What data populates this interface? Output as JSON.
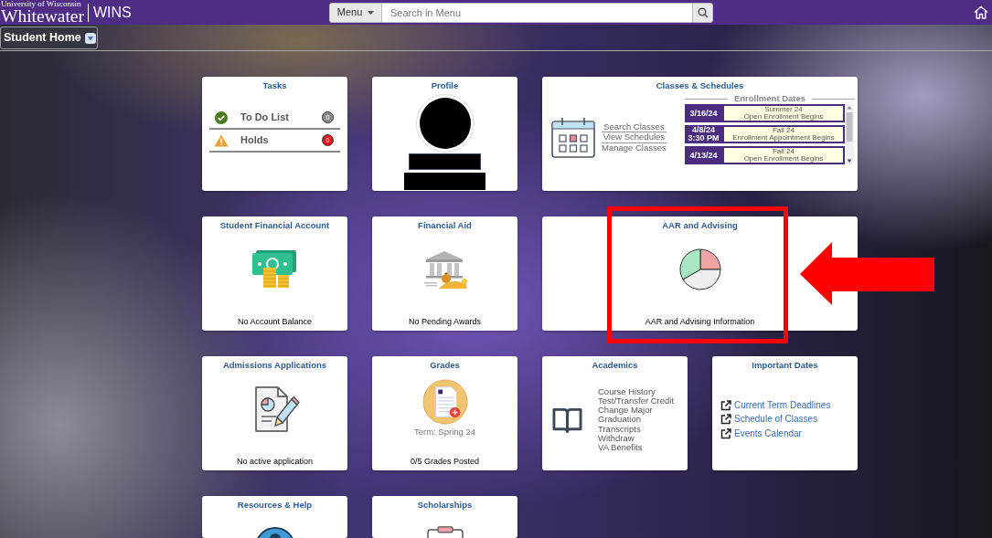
{
  "header": {
    "logo": {
      "line_1": "University of Wisconsin",
      "line_2": "Whitewater",
      "app_name": "WINS"
    },
    "menu_button": "Menu",
    "search": {
      "placeholder": "Search in Menu"
    }
  },
  "page_title": "Student Home",
  "tiles": [
    {
      "kind": "tasks",
      "title": "Tasks",
      "highlighted": false,
      "tasks": [
        {
          "kind": "ok",
          "label": "To Do List",
          "count": "0",
          "color": "#8c8c8c"
        },
        {
          "kind": "alert",
          "label": "Holds",
          "count": "0",
          "color": "#e2141c"
        }
      ]
    },
    {
      "kind": "profile",
      "title": "Profile",
      "highlighted": false
    },
    {
      "kind": "classes",
      "title": "Classes & Schedules",
      "highlighted": false,
      "links": [
        "Search Classes",
        "View Schedules",
        "Manage Classes"
      ],
      "enrollment": {
        "heading": "Enrollment Dates",
        "items": [
          {
            "date": "3/16/24",
            "term": "Summer 24",
            "event": "Open Enrollment Begins"
          },
          {
            "date": "4/8/24",
            "time": "3:30 PM",
            "term": "Fall 24",
            "event": "Enrollment Appointment Begins"
          },
          {
            "date": "4/13/24",
            "term": "Fall 24",
            "event": "Open Enrollment Begins"
          }
        ]
      }
    },
    {
      "kind": "account",
      "title": "Student Financial Account",
      "highlighted": false,
      "footer": "No Account Balance"
    },
    {
      "kind": "aid",
      "title": "Financial Aid",
      "highlighted": false,
      "footer": "No Pending Awards"
    },
    {
      "kind": "advising",
      "title": "AAR and Advising",
      "highlighted": true,
      "footer": "AAR and Advising Information"
    },
    {
      "kind": "admissions",
      "title": "Admissions Applications",
      "highlighted": false,
      "footer": "No active application"
    },
    {
      "kind": "grades",
      "title": "Grades",
      "highlighted": false,
      "term": "Term: Spring 24",
      "footer": "0/5 Grades Posted"
    },
    {
      "kind": "academics",
      "title": "Academics",
      "highlighted": false,
      "links": [
        "Course History",
        "Test/Transfer Credit",
        "Change Major",
        "Graduation",
        "Transcripts",
        "Withdraw",
        "VA Benefits"
      ]
    },
    {
      "kind": "dates",
      "title": "Important Dates",
      "highlighted": false,
      "links": [
        "Current Term Deadlines",
        "Schedule of Classes",
        "Events Calendar"
      ]
    },
    {
      "kind": "resources",
      "title": "Resources & Help",
      "highlighted": false
    },
    {
      "kind": "scholarships",
      "title": "Scholarships",
      "highlighted": false
    }
  ]
}
